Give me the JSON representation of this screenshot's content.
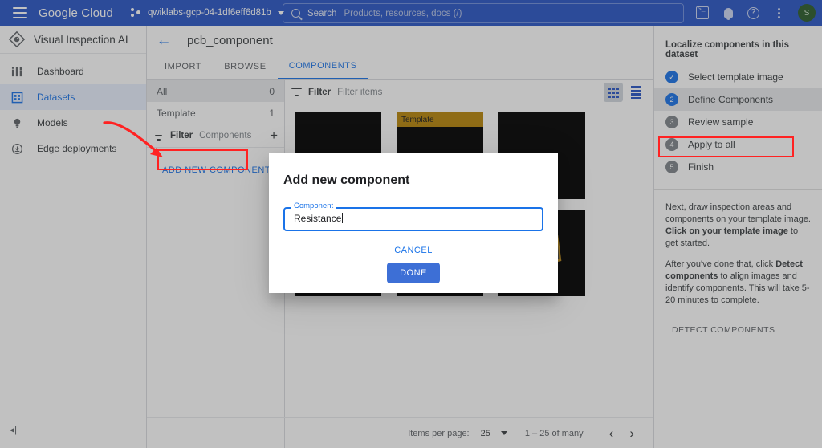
{
  "topbar": {
    "product": "Google Cloud",
    "project": "qwiklabs-gcp-04-1df6eff6d81b",
    "search_label": "Search",
    "search_placeholder": "Products, resources, docs (/)",
    "avatar_initial": "S",
    "icons": [
      "menu-icon",
      "project-icon",
      "search-icon",
      "cloud-shell-icon",
      "notifications-icon",
      "help-icon",
      "more-options-icon",
      "account-avatar"
    ]
  },
  "sidebar": {
    "title": "Visual Inspection AI",
    "items": [
      {
        "label": "Dashboard",
        "icon": "dashboard-icon",
        "active": false
      },
      {
        "label": "Datasets",
        "icon": "datasets-icon",
        "active": true
      },
      {
        "label": "Models",
        "icon": "models-icon",
        "active": false
      },
      {
        "label": "Edge deployments",
        "icon": "edge-deployments-icon",
        "active": false
      }
    ],
    "collapse_glyph": "◂|"
  },
  "dataset": {
    "name": "pcb_component",
    "back_glyph": "←",
    "tabs": [
      {
        "label": "IMPORT",
        "selected": false
      },
      {
        "label": "BROWSE",
        "selected": false
      },
      {
        "label": "COMPONENTS",
        "selected": true
      }
    ]
  },
  "components_panel": {
    "rows": [
      {
        "label": "All",
        "count": "0",
        "selected": true
      },
      {
        "label": "Template",
        "count": "1",
        "selected": false
      }
    ],
    "filter_label": "Filter",
    "filter_placeholder": "Components",
    "add_glyph": "+",
    "add_new_label": "ADD NEW COMPONENT"
  },
  "grid": {
    "filter_label": "Filter",
    "filter_placeholder": "Filter items",
    "grid_view_title": "grid-view",
    "list_view_title": "list-view",
    "template_badge": "Template",
    "tiles": [
      {
        "label": "",
        "template": false,
        "pcb": false
      },
      {
        "label": "Template",
        "template": true,
        "pcb": false
      },
      {
        "label": "",
        "template": false,
        "pcb": false
      },
      {
        "label": "",
        "template": false,
        "pcb": true
      },
      {
        "label": "",
        "template": false,
        "pcb": true
      },
      {
        "label": "",
        "template": false,
        "pcb": true
      }
    ]
  },
  "paginator": {
    "items_per_page_label": "Items per page:",
    "items_per_page_value": "25",
    "range": "1 – 25 of many",
    "prev_glyph": "‹",
    "next_glyph": "›"
  },
  "right_panel": {
    "title": "Localize components in this dataset",
    "steps": [
      {
        "badge": "✓",
        "label": "Select template image",
        "state": "done"
      },
      {
        "badge": "2",
        "label": "Define Components",
        "state": "current"
      },
      {
        "badge": "3",
        "label": "Review sample",
        "state": "todo"
      },
      {
        "badge": "4",
        "label": "Apply to all",
        "state": "todo"
      },
      {
        "badge": "5",
        "label": "Finish",
        "state": "todo"
      }
    ],
    "para1_a": "Next, draw inspection areas and components on your template image. ",
    "para1_b": "Click on your template image",
    "para1_c": " to get started.",
    "para2_a": "After you've done that, click ",
    "para2_b": "Detect components",
    "para2_c": " to align images and identify components. This will take 5-20 minutes to complete.",
    "detect_button": "DETECT COMPONENTS"
  },
  "dialog": {
    "title": "Add new component",
    "field_label": "Component",
    "field_value": "Resistance",
    "cancel_label": "CANCEL",
    "done_label": "DONE"
  },
  "annotations": {
    "highlight_color": "#ff2222",
    "arrow_name": "red-annotation-arrow",
    "boxes": [
      "add-new-component-highlight",
      "define-components-highlight"
    ]
  },
  "colors": {
    "brand_blue": "#2a56c6",
    "accent_blue": "#1a73e8",
    "template_gold": "#b8860b",
    "annotation_red": "#ff2222"
  }
}
